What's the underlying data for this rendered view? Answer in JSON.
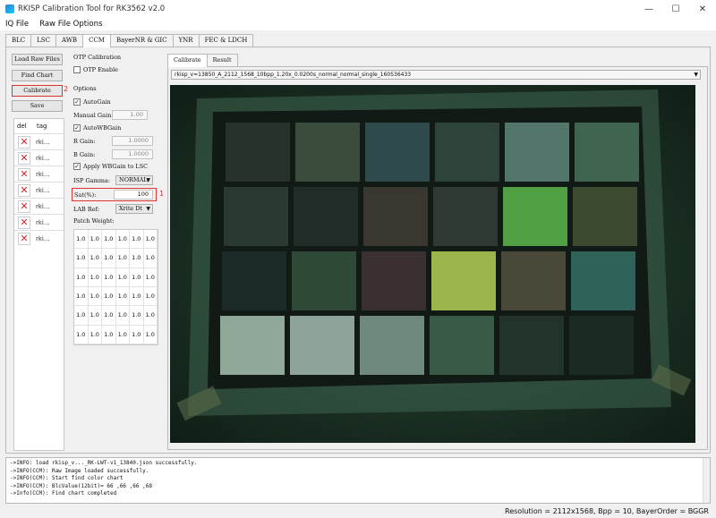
{
  "window": {
    "title": "RKISP Calibration Tool for RK3562 v2.0",
    "controls": [
      "—",
      "☐",
      "✕"
    ]
  },
  "menu": [
    "IQ File",
    "Raw File Options"
  ],
  "main_tabs": [
    "BLC",
    "LSC",
    "AWB",
    "CCM",
    "BayerNR & GIC",
    "YNR",
    "FEC & LDCH"
  ],
  "active_tab": "CCM",
  "left_buttons": {
    "load": "Load Raw Files",
    "find": "Find Chart",
    "calibrate": "Calibrate",
    "save": "Save"
  },
  "annotations": {
    "one": "1",
    "two": "2"
  },
  "tag_table": {
    "col_del": "del",
    "col_tag": "tag",
    "rows": [
      "rki...",
      "rki...",
      "rki...",
      "rki...",
      "rki...",
      "rki...",
      "rki..."
    ]
  },
  "otp": {
    "section": "OTP Calibration",
    "enable": "OTP Enable"
  },
  "options": {
    "section": "Options",
    "autogain": "AutoGain",
    "manual_gain_label": "Manual Gain:",
    "manual_gain_value": "1.00",
    "autowbgain": "AutoWBGain",
    "r_gain_label": "R Gain:",
    "r_gain_value": "1.0000",
    "b_gain_label": "B Gain:",
    "b_gain_value": "1.0000",
    "apply_wb": "Apply WBGain to LSC",
    "isp_gamma_label": "ISP Gamma:",
    "isp_gamma_value": "NORMAL",
    "sat_label": "Sat(%):",
    "sat_value": "100",
    "lab_ref_label": "LAB Ref:",
    "lab_ref_value": "Xrite Dt",
    "patch_weight_label": "Patch Weight:"
  },
  "patch_weights": [
    "1.0",
    "1.0",
    "1.0",
    "1.0",
    "1.0",
    "1.0",
    "1.0",
    "1.0",
    "1.0",
    "1.0",
    "1.0",
    "1.0",
    "1.0",
    "1.0",
    "1.0",
    "1.0",
    "1.0",
    "1.0",
    "1.0",
    "1.0",
    "1.0",
    "1.0",
    "1.0",
    "1.0",
    "1.0",
    "1.0",
    "1.0",
    "1.0",
    "1.0",
    "1.0",
    "1.0",
    "1.0",
    "1.0",
    "1.0",
    "1.0",
    "1.0"
  ],
  "sub_tabs": [
    "Calibrate",
    "Result"
  ],
  "file_select": "rkisp_v=13850_A_2112_1568_10bpp_1.20x_0.0200s_normal_normal_single_160536433",
  "log": [
    "->INFO: load rkisp_v..._RK-LWT-v1_13840.json successfully.",
    "->INFO(CCM): Raw Image loaded successfully.",
    "->INFO(CCM): Start find color chart",
    "->INFO(CCM): BlcValue(12bit)= 66 ,66 ,66 ,68",
    "->Info(CCM): Find chart completed"
  ],
  "status": "Resolution = 2112x1568, Bpp = 10, BayerOrder = BGGR",
  "patch_colors": [
    [
      "#27332a",
      "#3b4b3c",
      "#2f4a4a",
      "#2e4438",
      "#52766c",
      "#3f6450"
    ],
    [
      "#2a3a30",
      "#1f2c28",
      "#3a3630",
      "#2f3a33",
      "#52a044",
      "#3c4a30"
    ],
    [
      "#1d2a2a",
      "#2e4a36",
      "#3a3030",
      "#9db54d",
      "#4a4838",
      "#2f6258"
    ],
    [
      "#8fa89a",
      "#8ea498",
      "#6f8a7c",
      "#3a5a48",
      "#22342a",
      "#1b2a22"
    ]
  ]
}
